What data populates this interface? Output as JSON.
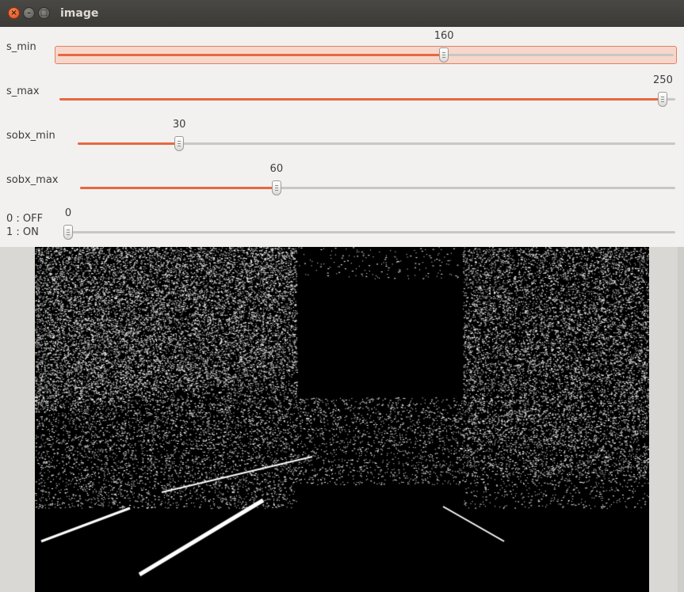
{
  "window": {
    "title": "image"
  },
  "trackbars": [
    {
      "label": "s_min",
      "value": "160",
      "fraction": 0.627,
      "focused": true
    },
    {
      "label": "s_max",
      "value": "250",
      "fraction": 0.98,
      "focused": false
    },
    {
      "label": "sobx_min",
      "value": "30",
      "fraction": 0.17,
      "focused": false
    },
    {
      "label": "sobx_max",
      "value": "60",
      "fraction": 0.33,
      "focused": false
    },
    {
      "label": "0 : OFF\n1 : ON",
      "value": "0",
      "fraction": 0.0,
      "focused": false
    }
  ],
  "colors": {
    "accent": "#e7683f",
    "background": "#f2f1f0",
    "titlebar": "#3b3a36"
  },
  "icons": {
    "close": "close-icon",
    "minimize": "minimize-icon",
    "maximize": "maximize-icon"
  }
}
